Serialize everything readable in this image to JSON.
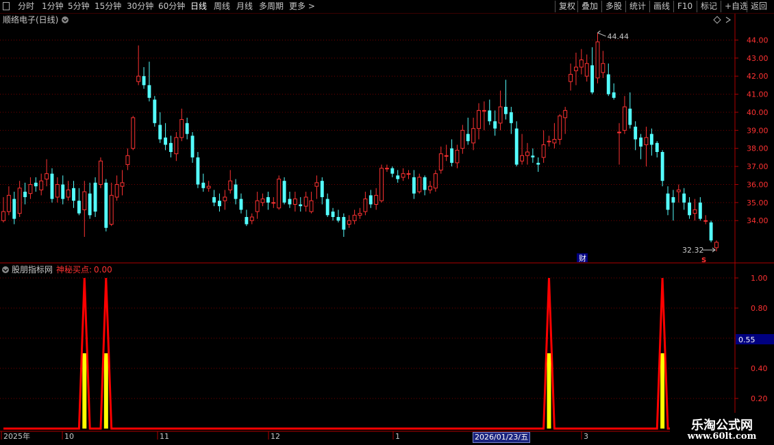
{
  "toolbar": {
    "periods": [
      "分时",
      "1分钟",
      "5分钟",
      "15分钟",
      "30分钟",
      "60分钟",
      "日线",
      "周线",
      "月线",
      "多周期",
      "更多 >"
    ],
    "active_period": "日线",
    "right_buttons": [
      "复权",
      "叠加",
      "多股",
      "统计",
      "画线",
      "F10",
      "标记",
      "+自选",
      "返回"
    ]
  },
  "price_panel": {
    "title": "顺络电子(日线)",
    "high_label": "44.44",
    "low_label": "32.32",
    "fin_badge": "财",
    "s_marker": "S",
    "y_ticks": [
      "44.00",
      "43.00",
      "42.00",
      "41.00",
      "40.00",
      "39.00",
      "38.00",
      "37.00",
      "36.00",
      "35.00",
      "34.00"
    ]
  },
  "indicator_panel": {
    "name": "股朋指标网",
    "line_label": "神秘买点:",
    "line_value": "0.00",
    "y_ticks": [
      "1.00",
      "0.80",
      "0.40",
      "0.20"
    ],
    "cursor_value": "0.55"
  },
  "time_axis": {
    "labels": [
      "2025年",
      "10",
      "11",
      "12",
      "1",
      "3"
    ],
    "cursor_date": "2026/01/23/五"
  },
  "watermark": {
    "title": "乐淘公式网",
    "url": "www.60lt.com"
  },
  "colors": {
    "up": "#ff3232",
    "down": "#54ffff",
    "signal": "#ff0000",
    "signal_fill": "#ffff00",
    "grid": "#7a0000"
  },
  "chart_data": {
    "type": "candlestick",
    "y_range": [
      32.0,
      44.7
    ],
    "candles": [
      {
        "o": 34.0,
        "c": 34.5,
        "h": 35.3,
        "l": 33.9
      },
      {
        "o": 34.5,
        "c": 35.4,
        "h": 35.9,
        "l": 34.3
      },
      {
        "o": 35.2,
        "c": 34.1,
        "h": 35.6,
        "l": 33.8
      },
      {
        "o": 34.4,
        "c": 35.8,
        "h": 36.2,
        "l": 34.2
      },
      {
        "o": 35.6,
        "c": 35.3,
        "h": 36.1,
        "l": 34.9
      },
      {
        "o": 35.5,
        "c": 36.0,
        "h": 36.4,
        "l": 35.2
      },
      {
        "o": 36.1,
        "c": 35.9,
        "h": 36.4,
        "l": 35.6
      },
      {
        "o": 35.7,
        "c": 36.2,
        "h": 36.6,
        "l": 35.4
      },
      {
        "o": 36.3,
        "c": 36.6,
        "h": 37.4,
        "l": 35.9
      },
      {
        "o": 36.6,
        "c": 35.2,
        "h": 36.9,
        "l": 35.0
      },
      {
        "o": 35.3,
        "c": 36.0,
        "h": 36.4,
        "l": 35.0
      },
      {
        "o": 36.0,
        "c": 35.2,
        "h": 36.5,
        "l": 34.9
      },
      {
        "o": 35.3,
        "c": 35.7,
        "h": 36.2,
        "l": 35.1
      },
      {
        "o": 35.8,
        "c": 35.1,
        "h": 36.2,
        "l": 34.7
      },
      {
        "o": 35.1,
        "c": 34.4,
        "h": 35.8,
        "l": 34.3
      },
      {
        "o": 34.6,
        "c": 35.6,
        "h": 36.2,
        "l": 33.1
      },
      {
        "o": 35.5,
        "c": 34.3,
        "h": 36.1,
        "l": 34.1
      },
      {
        "o": 36.1,
        "c": 34.5,
        "h": 36.4,
        "l": 34.2
      },
      {
        "o": 36.0,
        "c": 37.3,
        "h": 37.5,
        "l": 35.8
      },
      {
        "o": 36.1,
        "c": 33.6,
        "h": 36.3,
        "l": 33.4
      },
      {
        "o": 33.8,
        "c": 35.4,
        "h": 36.1,
        "l": 33.7
      },
      {
        "o": 35.3,
        "c": 36.0,
        "h": 36.5,
        "l": 35.1
      },
      {
        "o": 35.9,
        "c": 36.1,
        "h": 36.8,
        "l": 35.4
      },
      {
        "o": 37.1,
        "c": 37.6,
        "h": 38.0,
        "l": 36.8
      },
      {
        "o": 38.0,
        "c": 39.7,
        "h": 39.8,
        "l": 37.9
      },
      {
        "o": 41.7,
        "c": 42.0,
        "h": 43.7,
        "l": 41.5
      },
      {
        "o": 42.0,
        "c": 41.5,
        "h": 42.5,
        "l": 41.3
      },
      {
        "o": 41.5,
        "c": 40.8,
        "h": 42.8,
        "l": 40.6
      },
      {
        "o": 40.7,
        "c": 39.4,
        "h": 40.9,
        "l": 39.2
      },
      {
        "o": 39.3,
        "c": 38.5,
        "h": 40.0,
        "l": 38.3
      },
      {
        "o": 38.6,
        "c": 38.2,
        "h": 39.4,
        "l": 37.9
      },
      {
        "o": 38.3,
        "c": 37.8,
        "h": 38.7,
        "l": 37.5
      },
      {
        "o": 37.7,
        "c": 38.6,
        "h": 38.9,
        "l": 37.3
      },
      {
        "o": 38.6,
        "c": 39.6,
        "h": 40.2,
        "l": 38.4
      },
      {
        "o": 39.4,
        "c": 38.8,
        "h": 39.7,
        "l": 38.5
      },
      {
        "o": 38.7,
        "c": 37.5,
        "h": 38.9,
        "l": 37.2
      },
      {
        "o": 37.5,
        "c": 36.0,
        "h": 37.8,
        "l": 35.8
      },
      {
        "o": 36.1,
        "c": 35.8,
        "h": 36.6,
        "l": 35.6
      },
      {
        "o": 35.8,
        "c": 35.9,
        "h": 36.2,
        "l": 35.6
      },
      {
        "o": 35.3,
        "c": 35.0,
        "h": 35.7,
        "l": 34.8
      },
      {
        "o": 35.1,
        "c": 34.8,
        "h": 35.5,
        "l": 34.5
      },
      {
        "o": 35.1,
        "c": 35.3,
        "h": 35.7,
        "l": 34.6
      },
      {
        "o": 35.7,
        "c": 36.2,
        "h": 36.8,
        "l": 35.5
      },
      {
        "o": 36.0,
        "c": 35.2,
        "h": 36.3,
        "l": 34.9
      },
      {
        "o": 35.2,
        "c": 34.6,
        "h": 35.5,
        "l": 34.4
      },
      {
        "o": 34.2,
        "c": 33.8,
        "h": 34.6,
        "l": 33.7
      },
      {
        "o": 34.0,
        "c": 34.2,
        "h": 34.4,
        "l": 33.8
      },
      {
        "o": 34.5,
        "c": 35.1,
        "h": 35.6,
        "l": 34.1
      },
      {
        "o": 35.0,
        "c": 35.2,
        "h": 35.5,
        "l": 34.8
      },
      {
        "o": 35.3,
        "c": 35.0,
        "h": 35.6,
        "l": 34.6
      },
      {
        "o": 35.0,
        "c": 35.0,
        "h": 35.3,
        "l": 34.7
      },
      {
        "o": 34.7,
        "c": 36.3,
        "h": 36.5,
        "l": 34.6
      },
      {
        "o": 36.2,
        "c": 35.0,
        "h": 36.4,
        "l": 34.9
      },
      {
        "o": 35.2,
        "c": 34.9,
        "h": 35.6,
        "l": 34.7
      },
      {
        "o": 34.9,
        "c": 35.2,
        "h": 35.6,
        "l": 34.5
      },
      {
        "o": 34.9,
        "c": 34.8,
        "h": 35.3,
        "l": 34.5
      },
      {
        "o": 34.8,
        "c": 35.3,
        "h": 35.6,
        "l": 34.5
      },
      {
        "o": 34.5,
        "c": 35.1,
        "h": 35.6,
        "l": 34.4
      },
      {
        "o": 35.9,
        "c": 36.1,
        "h": 36.5,
        "l": 35.2
      },
      {
        "o": 36.2,
        "c": 35.3,
        "h": 36.4,
        "l": 34.9
      },
      {
        "o": 35.2,
        "c": 34.3,
        "h": 35.5,
        "l": 34.2
      },
      {
        "o": 34.5,
        "c": 34.2,
        "h": 34.7,
        "l": 34.0
      },
      {
        "o": 34.2,
        "c": 34.0,
        "h": 34.6,
        "l": 33.9
      },
      {
        "o": 34.2,
        "c": 33.5,
        "h": 34.4,
        "l": 33.1
      },
      {
        "o": 33.8,
        "c": 34.0,
        "h": 34.3,
        "l": 33.6
      },
      {
        "o": 34.0,
        "c": 34.3,
        "h": 34.6,
        "l": 33.8
      },
      {
        "o": 34.3,
        "c": 34.4,
        "h": 34.7,
        "l": 34.1
      },
      {
        "o": 34.5,
        "c": 35.2,
        "h": 35.6,
        "l": 34.3
      },
      {
        "o": 35.4,
        "c": 34.9,
        "h": 35.7,
        "l": 34.7
      },
      {
        "o": 34.9,
        "c": 35.4,
        "h": 35.8,
        "l": 34.6
      },
      {
        "o": 35.1,
        "c": 36.9,
        "h": 37.1,
        "l": 35.0
      },
      {
        "o": 36.9,
        "c": 36.9,
        "h": 37.1,
        "l": 36.7
      },
      {
        "o": 36.9,
        "c": 36.6,
        "h": 37.0,
        "l": 36.4
      },
      {
        "o": 36.5,
        "c": 36.3,
        "h": 36.8,
        "l": 36.1
      },
      {
        "o": 36.4,
        "c": 36.6,
        "h": 36.9,
        "l": 36.2
      },
      {
        "o": 36.6,
        "c": 36.6,
        "h": 36.8,
        "l": 36.3
      },
      {
        "o": 36.4,
        "c": 35.5,
        "h": 36.8,
        "l": 35.2
      },
      {
        "o": 35.6,
        "c": 36.4,
        "h": 36.6,
        "l": 35.5
      },
      {
        "o": 36.4,
        "c": 35.7,
        "h": 36.5,
        "l": 35.4
      },
      {
        "o": 35.7,
        "c": 35.9,
        "h": 36.2,
        "l": 35.5
      },
      {
        "o": 35.8,
        "c": 36.6,
        "h": 36.8,
        "l": 35.6
      },
      {
        "o": 36.8,
        "c": 37.7,
        "h": 38.1,
        "l": 36.6
      },
      {
        "o": 37.6,
        "c": 37.6,
        "h": 38.2,
        "l": 37.3
      },
      {
        "o": 38.0,
        "c": 37.2,
        "h": 38.5,
        "l": 37.0
      },
      {
        "o": 37.2,
        "c": 37.9,
        "h": 38.2,
        "l": 36.9
      },
      {
        "o": 38.0,
        "c": 39.0,
        "h": 39.3,
        "l": 37.7
      },
      {
        "o": 38.8,
        "c": 38.4,
        "h": 39.7,
        "l": 38.2
      },
      {
        "o": 38.3,
        "c": 39.1,
        "h": 39.7,
        "l": 37.9
      },
      {
        "o": 39.1,
        "c": 40.1,
        "h": 40.5,
        "l": 38.5
      },
      {
        "o": 40.1,
        "c": 40.1,
        "h": 40.6,
        "l": 39.0
      },
      {
        "o": 40.1,
        "c": 39.5,
        "h": 40.7,
        "l": 39.3
      },
      {
        "o": 39.5,
        "c": 39.1,
        "h": 40.1,
        "l": 38.7
      },
      {
        "o": 39.4,
        "c": 40.3,
        "h": 41.2,
        "l": 39.0
      },
      {
        "o": 40.3,
        "c": 39.9,
        "h": 41.8,
        "l": 39.6
      },
      {
        "o": 40.0,
        "c": 39.4,
        "h": 40.3,
        "l": 38.8
      },
      {
        "o": 39.1,
        "c": 37.1,
        "h": 39.5,
        "l": 37.0
      },
      {
        "o": 37.3,
        "c": 37.6,
        "h": 38.8,
        "l": 37.1
      },
      {
        "o": 37.6,
        "c": 37.8,
        "h": 38.3,
        "l": 37.1
      },
      {
        "o": 37.6,
        "c": 37.5,
        "h": 38.0,
        "l": 37.2
      },
      {
        "o": 37.2,
        "c": 37.1,
        "h": 37.5,
        "l": 36.7
      },
      {
        "o": 37.5,
        "c": 38.2,
        "h": 39.0,
        "l": 37.2
      },
      {
        "o": 38.4,
        "c": 38.4,
        "h": 38.7,
        "l": 38.1
      },
      {
        "o": 38.3,
        "c": 38.5,
        "h": 39.4,
        "l": 38.0
      },
      {
        "o": 38.5,
        "c": 39.8,
        "h": 39.9,
        "l": 38.2
      },
      {
        "o": 39.7,
        "c": 40.1,
        "h": 40.3,
        "l": 38.8
      },
      {
        "o": 41.7,
        "c": 42.1,
        "h": 42.7,
        "l": 41.2
      },
      {
        "o": 42.3,
        "c": 42.5,
        "h": 43.3,
        "l": 41.5
      },
      {
        "o": 42.5,
        "c": 42.9,
        "h": 43.5,
        "l": 42.1
      },
      {
        "o": 42.0,
        "c": 42.7,
        "h": 43.2,
        "l": 41.7
      },
      {
        "o": 42.6,
        "c": 41.1,
        "h": 43.6,
        "l": 41.0
      },
      {
        "o": 41.9,
        "c": 43.9,
        "h": 44.4,
        "l": 41.6
      },
      {
        "o": 42.2,
        "c": 42.7,
        "h": 43.4,
        "l": 41.9
      },
      {
        "o": 42.1,
        "c": 41.0,
        "h": 42.7,
        "l": 40.9
      },
      {
        "o": 41.1,
        "c": 40.8,
        "h": 41.6,
        "l": 40.7
      },
      {
        "o": 38.9,
        "c": 38.9,
        "h": 39.4,
        "l": 37.1
      },
      {
        "o": 39.0,
        "c": 40.3,
        "h": 40.9,
        "l": 38.8
      },
      {
        "o": 40.2,
        "c": 39.3,
        "h": 41.1,
        "l": 39.1
      },
      {
        "o": 39.2,
        "c": 38.5,
        "h": 39.5,
        "l": 37.9
      },
      {
        "o": 38.6,
        "c": 38.1,
        "h": 38.8,
        "l": 37.4
      },
      {
        "o": 38.2,
        "c": 38.6,
        "h": 39.2,
        "l": 37.0
      },
      {
        "o": 38.8,
        "c": 38.2,
        "h": 39.1,
        "l": 37.6
      },
      {
        "o": 38.3,
        "c": 37.8,
        "h": 38.4,
        "l": 37.5
      },
      {
        "o": 37.8,
        "c": 36.2,
        "h": 37.9,
        "l": 35.9
      },
      {
        "o": 35.5,
        "c": 34.6,
        "h": 35.9,
        "l": 34.3
      },
      {
        "o": 35.3,
        "c": 35.0,
        "h": 35.7,
        "l": 34.0
      },
      {
        "o": 35.6,
        "c": 35.7,
        "h": 36.0,
        "l": 35.0
      },
      {
        "o": 35.5,
        "c": 35.0,
        "h": 35.8,
        "l": 34.6
      },
      {
        "o": 35.0,
        "c": 34.3,
        "h": 35.3,
        "l": 34.1
      },
      {
        "o": 34.4,
        "c": 34.6,
        "h": 35.2,
        "l": 34.0
      },
      {
        "o": 35.0,
        "c": 34.1,
        "h": 35.3,
        "l": 34.0
      },
      {
        "o": 34.0,
        "c": 34.0,
        "h": 34.3,
        "l": 33.8
      },
      {
        "o": 33.9,
        "c": 32.9,
        "h": 34.0,
        "l": 32.8
      },
      {
        "o": 32.5,
        "c": 32.8,
        "h": 32.9,
        "l": 32.3
      }
    ],
    "indicator": {
      "name": "神秘买点",
      "y_range": [
        0,
        1.0
      ],
      "signal_indices": [
        15,
        19,
        101,
        122
      ],
      "bar_value": 0.5,
      "peak_value": 1.0
    }
  }
}
